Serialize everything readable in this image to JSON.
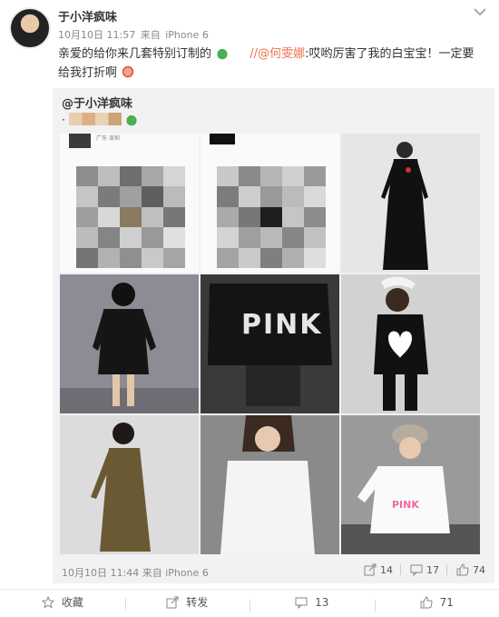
{
  "post": {
    "author": "于小洋疯味",
    "date": "10月10日 11:57",
    "source_prefix": "来自",
    "source": "iPhone 6",
    "text_part1": "亲爱的给你来几套特别订制的",
    "separator": "//",
    "mention": "@何雯娜",
    "text_part2": ":哎哟厉害了我的白宝宝！一定要给我打折啊",
    "icons": [
      "avatar",
      "chevron-down-icon",
      "green-emoji-icon",
      "red-emoji-icon"
    ]
  },
  "repost": {
    "author": "@于小洋疯味",
    "line2_prefix": "·",
    "photo1_caption": "广东 深圳",
    "photo5_text": "PINK",
    "photo9_text": "PINK",
    "date": "10月10日 11:44",
    "source_prefix": "来自",
    "source": "iPhone 6",
    "share_count": "14",
    "comment_count": "17",
    "like_count": "74"
  },
  "actions": {
    "favorite": "收藏",
    "forward": "转发",
    "comments": "13",
    "likes": "71"
  },
  "colors": {
    "mention": "#eb7350",
    "repost_bg": "#f2f2f5",
    "muted": "#888888"
  }
}
